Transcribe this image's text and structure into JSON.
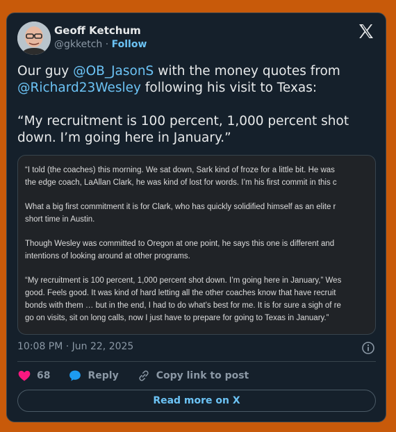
{
  "author": {
    "name": "Geoff Ketchum",
    "handle": "@gkketch",
    "separator": " · ",
    "follow_label": "Follow"
  },
  "tweet": {
    "line1_prefix": "Our guy ",
    "mention1": "@OB_JasonS",
    "line1_suffix": " with the money quotes from",
    "mention2": "@Richard23Wesley",
    "line2_suffix": " following his visit to Texas:",
    "quote_line1": "“My recruitment is 100 percent, 1,000 percent shot",
    "quote_line2": "down. I’m going here in January.”"
  },
  "media": {
    "paragraphs": [
      [
        "“I told (the coaches) this morning. We sat down, Sark kind of froze for a little bit. He was",
        "the edge coach, LaAllan Clark, he was kind of lost for words. I’m his first commit in this c"
      ],
      [
        "What a big first commitment it is for Clark, who has quickly solidified himself as an elite r",
        "short time in Austin."
      ],
      [
        "Though Wesley was committed to Oregon at one point, he says this one is different and",
        "intentions of looking around at other programs."
      ],
      [
        "“My recruitment is 100 percent, 1,000 percent shot down. I’m going here in January,” Wes",
        "good. Feels good. It was kind of hard letting all the other coaches know that have recruit",
        "bonds with them … but in the end, I had to do what’s best for me. It is for sure a sigh of re",
        "go on visits, sit on long calls, now I just have to prepare for going to Texas in January.”"
      ]
    ]
  },
  "meta": {
    "timestamp": "10:08 PM · Jun 22, 2025"
  },
  "actions": {
    "likes": "68",
    "reply_label": "Reply",
    "copy_label": "Copy link to post",
    "read_more_label": "Read more on X"
  },
  "colors": {
    "accent": "#6cc3f5",
    "like": "#f91880",
    "reply": "#1d9bf0",
    "card_bg": "#15202b",
    "page_bg": "#c85a0a"
  }
}
